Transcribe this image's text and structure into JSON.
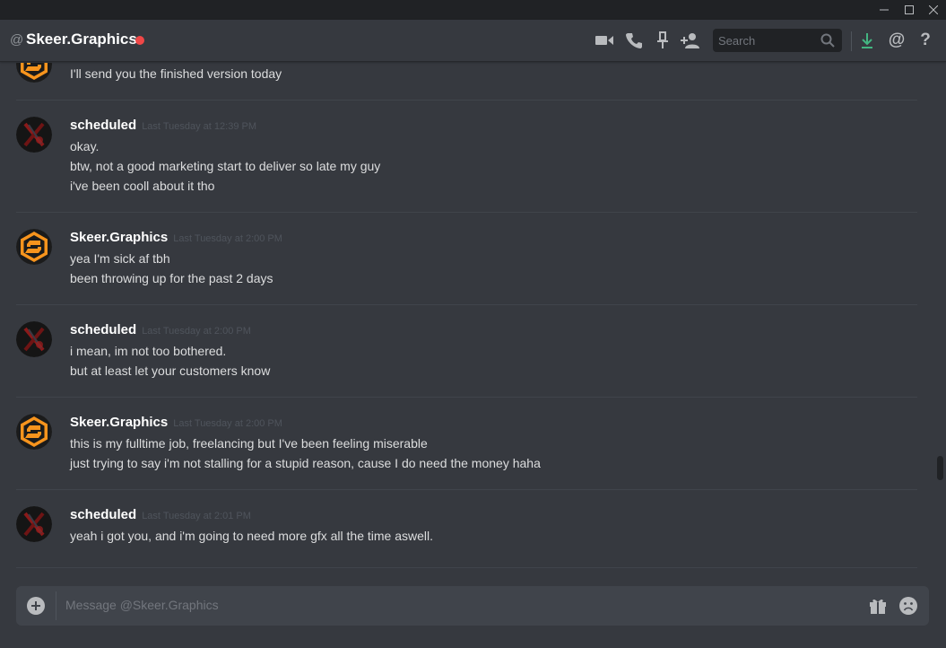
{
  "window": {
    "minimize": "—",
    "maximize": "□",
    "close": "✕"
  },
  "header": {
    "at_symbol": "@",
    "channel_name": "Skeer.Graphics",
    "status_color": "#f04747",
    "icons": [
      "video-icon",
      "phone-icon",
      "pin-icon",
      "add-friend-icon",
      "download-icon",
      "mention-icon",
      "help-icon"
    ],
    "search": {
      "placeholder": "Search"
    },
    "mention_label": "@",
    "help_label": "?"
  },
  "messages": [
    {
      "author": "",
      "timestamp": "",
      "lines": [
        "I'll send you the finished version today"
      ],
      "avatar": "skeer"
    },
    {
      "author": "scheduled",
      "timestamp": "Last Tuesday at 12:39 PM",
      "lines": [
        "okay.",
        "btw, not a good marketing start to deliver so late my guy",
        "i've been cooll about it tho"
      ],
      "avatar": "scheduled"
    },
    {
      "author": "Skeer.Graphics",
      "timestamp": "Last Tuesday at 2:00 PM",
      "lines": [
        "yea I'm sick af tbh",
        "been throwing up for the past 2 days"
      ],
      "avatar": "skeer"
    },
    {
      "author": "scheduled",
      "timestamp": "Last Tuesday at 2:00 PM",
      "lines": [
        "i mean, im not too bothered.",
        "but at least let your customers know"
      ],
      "avatar": "scheduled"
    },
    {
      "author": "Skeer.Graphics",
      "timestamp": "Last Tuesday at 2:00 PM",
      "lines": [
        "this is my fulltime job, freelancing but I've been feeling miserable",
        "just trying to say i'm not stalling for a stupid reason, cause I do need the money haha"
      ],
      "avatar": "skeer"
    },
    {
      "author": "scheduled",
      "timestamp": "Last Tuesday at 2:01 PM",
      "lines": [
        "yeah i got you, and i'm going to need more gfx all the time aswell."
      ],
      "avatar": "scheduled"
    }
  ],
  "composer": {
    "placeholder": "Message @Skeer.Graphics",
    "add_label": "+"
  },
  "colors": {
    "background": "#36393f",
    "accent_orange": "#f7941d",
    "download_green": "#43b581"
  }
}
